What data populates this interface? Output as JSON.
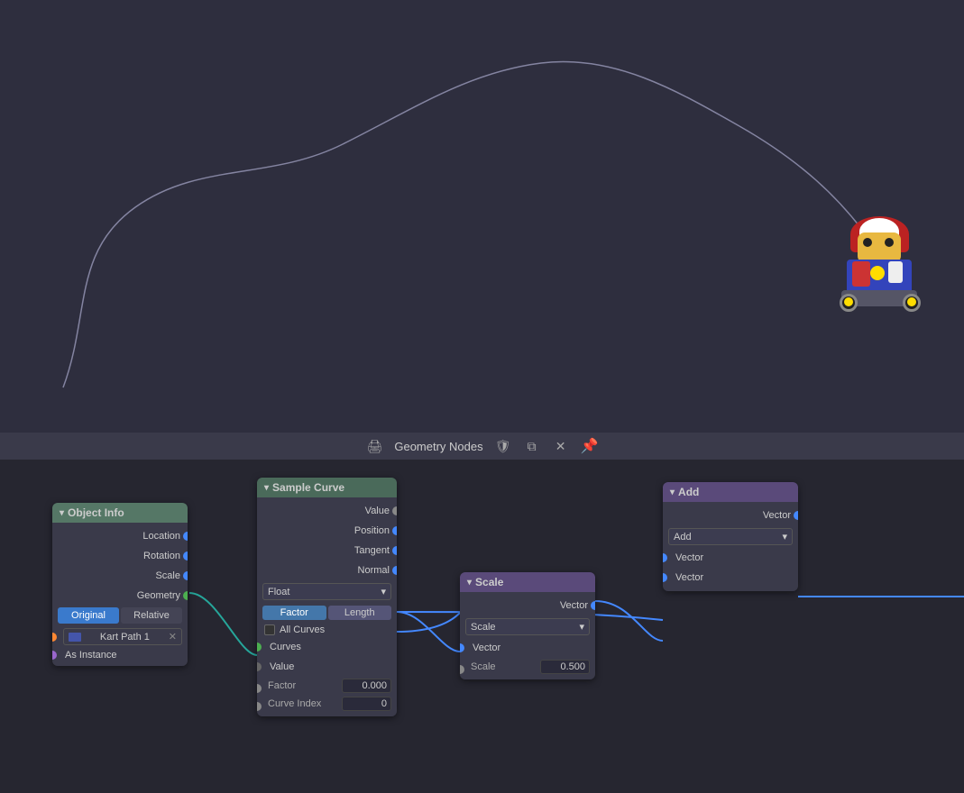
{
  "viewport": {
    "background": "#2e2e3e"
  },
  "toolbar": {
    "title": "Geometry Nodes",
    "icons": [
      "printer",
      "shield",
      "copy",
      "close",
      "pin"
    ]
  },
  "nodes": {
    "object_info": {
      "title": "Object Info",
      "header_color": "#557766",
      "rows": [
        {
          "label": "Location",
          "socket_color": "blue"
        },
        {
          "label": "Rotation",
          "socket_color": "blue"
        },
        {
          "label": "Scale",
          "socket_color": "blue"
        },
        {
          "label": "Geometry",
          "socket_color": "green"
        }
      ],
      "buttons": [
        "Original",
        "Relative"
      ],
      "active_button": "Original",
      "object_label": "Kart Path 1",
      "as_instance": "As Instance",
      "left_sockets": [
        {
          "color": "orange"
        },
        {
          "color": "purple"
        }
      ]
    },
    "sample_curve": {
      "title": "Sample Curve",
      "header_color": "#4a6a5a",
      "outputs": [
        {
          "label": "Value",
          "socket_color": "gray"
        },
        {
          "label": "Position",
          "socket_color": "blue"
        },
        {
          "label": "Tangent",
          "socket_color": "blue"
        },
        {
          "label": "Normal",
          "socket_color": "blue"
        }
      ],
      "dropdown_type": "Float",
      "buttons": [
        "Factor",
        "Length"
      ],
      "active_button": "Factor",
      "checkbox_label": "All Curves",
      "inputs": [
        {
          "label": "Curves",
          "socket_color": "green"
        },
        {
          "label": "Value",
          "socket_color": null
        },
        {
          "label": "Factor",
          "value": "0.000",
          "socket_color": "gray"
        },
        {
          "label": "Curve Index",
          "value": "0",
          "socket_color": "gray"
        }
      ]
    },
    "scale": {
      "title": "Scale",
      "header_color": "#5a4a7a",
      "outputs": [
        {
          "label": "Vector",
          "socket_color": "blue"
        }
      ],
      "dropdown_value": "Scale",
      "inputs": [
        {
          "label": "Vector",
          "socket_color": "blue"
        },
        {
          "label": "Scale",
          "value": "0.500",
          "socket_color": "gray"
        }
      ]
    },
    "add": {
      "title": "Add",
      "header_color": "#5a4a7a",
      "outputs": [
        {
          "label": "Vector",
          "socket_color": "blue"
        }
      ],
      "dropdown_value": "Add",
      "inputs": [
        {
          "label": "Vector",
          "socket_color": "blue"
        },
        {
          "label": "Vector",
          "socket_color": "blue"
        }
      ]
    }
  }
}
